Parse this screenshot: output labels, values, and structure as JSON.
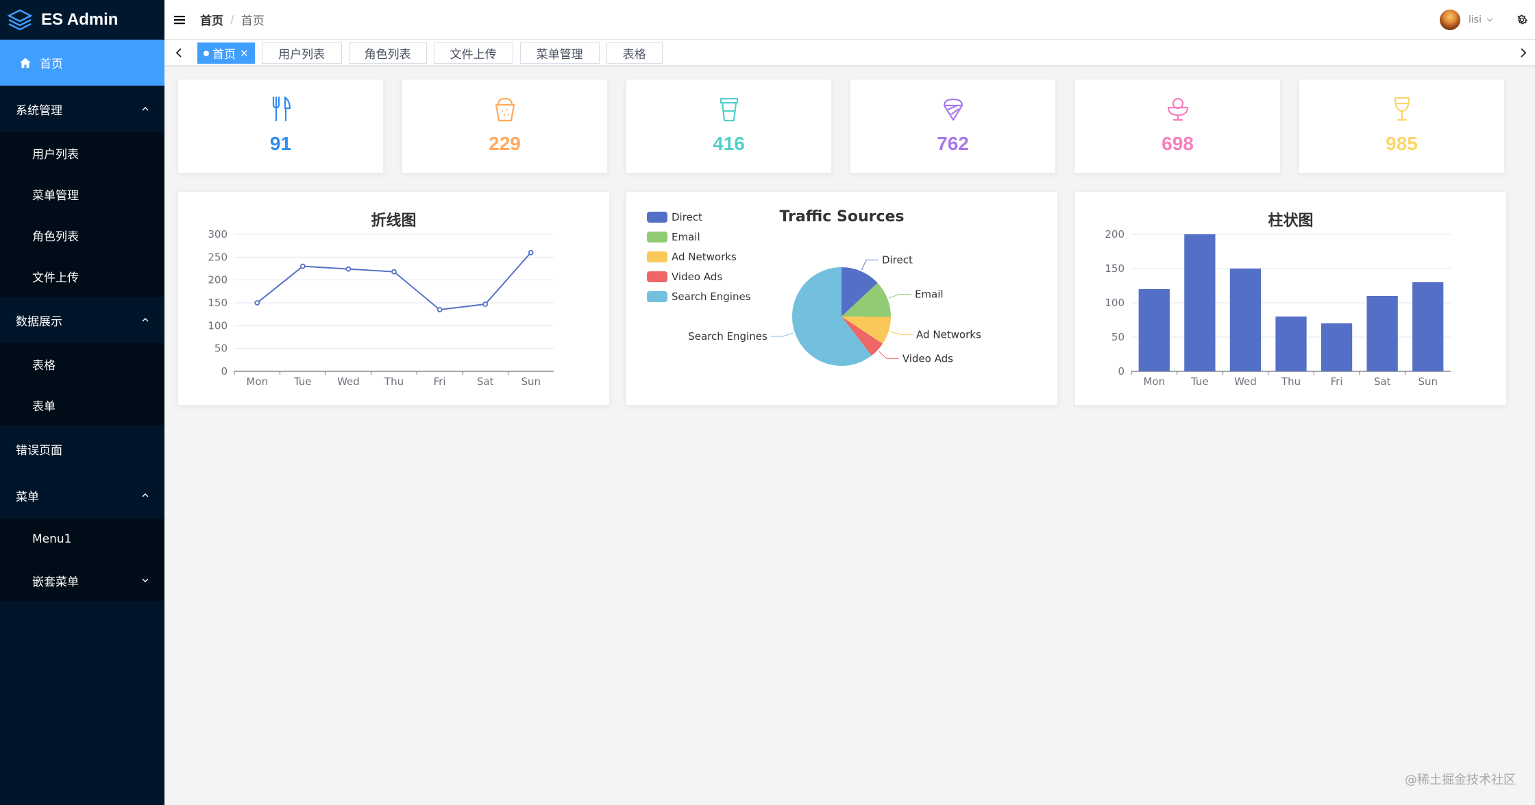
{
  "app": {
    "title": "ES Admin"
  },
  "sidebar": {
    "items": [
      {
        "label": "首页",
        "active": true
      },
      {
        "label": "系统管理",
        "expanded": true
      },
      {
        "label": "用户列表"
      },
      {
        "label": "菜单管理"
      },
      {
        "label": "角色列表"
      },
      {
        "label": "文件上传"
      },
      {
        "label": "数据展示",
        "expanded": true
      },
      {
        "label": "表格"
      },
      {
        "label": "表单"
      },
      {
        "label": "错误页面"
      },
      {
        "label": "菜单",
        "expanded": true
      },
      {
        "label": "Menu1"
      },
      {
        "label": "嵌套菜单",
        "expanded": false
      }
    ]
  },
  "header": {
    "breadcrumb": [
      "首页",
      "首页"
    ],
    "username": "lisi"
  },
  "tabs": [
    {
      "label": "首页",
      "active": true
    },
    {
      "label": "用户列表"
    },
    {
      "label": "角色列表"
    },
    {
      "label": "文件上传"
    },
    {
      "label": "菜单管理"
    },
    {
      "label": "表格"
    }
  ],
  "stats": [
    {
      "icon": "fork-knife-icon",
      "value": "91",
      "color": "#2d8cf0"
    },
    {
      "icon": "popcorn-icon",
      "value": "229",
      "color": "#ffaa5c"
    },
    {
      "icon": "cup-icon",
      "value": "416",
      "color": "#52d0c8"
    },
    {
      "icon": "ice-cream-icon",
      "value": "762",
      "color": "#a878ea"
    },
    {
      "icon": "sundae-icon",
      "value": "698",
      "color": "#f77fbe"
    },
    {
      "icon": "wine-glass-icon",
      "value": "985",
      "color": "#fcd66a"
    }
  ],
  "charts": {
    "line": {
      "title": "折线图"
    },
    "pie": {
      "title": "Traffic Sources"
    },
    "bar": {
      "title": "柱状图"
    }
  },
  "chart_data": [
    {
      "type": "line",
      "title": "折线图",
      "categories": [
        "Mon",
        "Tue",
        "Wed",
        "Thu",
        "Fri",
        "Sat",
        "Sun"
      ],
      "values": [
        150,
        230,
        224,
        218,
        135,
        147,
        260
      ],
      "yticks": [
        0,
        50,
        100,
        150,
        200,
        250,
        300
      ],
      "ylim": [
        0,
        300
      ],
      "color": "#5470c6"
    },
    {
      "type": "pie",
      "title": "Traffic Sources",
      "legend_position": "top-left",
      "slices": [
        {
          "name": "Direct",
          "value": 335,
          "color": "#5470c6"
        },
        {
          "name": "Email",
          "value": 310,
          "color": "#91cc75"
        },
        {
          "name": "Ad Networks",
          "value": 234,
          "color": "#fac858"
        },
        {
          "name": "Video Ads",
          "value": 135,
          "color": "#ee6666"
        },
        {
          "name": "Search Engines",
          "value": 1548,
          "color": "#73c0de"
        }
      ]
    },
    {
      "type": "bar",
      "title": "柱状图",
      "categories": [
        "Mon",
        "Tue",
        "Wed",
        "Thu",
        "Fri",
        "Sat",
        "Sun"
      ],
      "values": [
        120,
        200,
        150,
        80,
        70,
        110,
        130
      ],
      "yticks": [
        0,
        50,
        100,
        150,
        200
      ],
      "ylim": [
        0,
        200
      ],
      "color": "#5470c6"
    }
  ],
  "watermark": "@稀土掘金技术社区"
}
